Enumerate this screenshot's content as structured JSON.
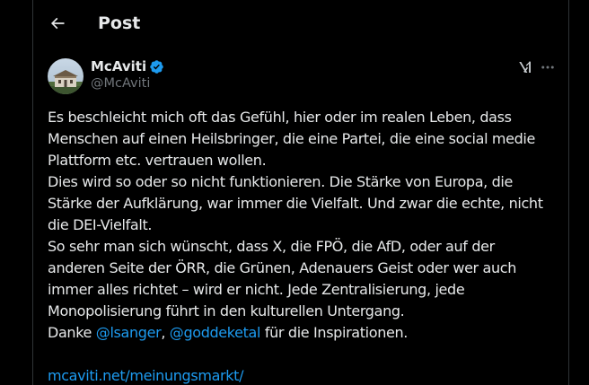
{
  "header": {
    "title": "Post"
  },
  "author": {
    "name": "McAviti",
    "handle": "@McAviti",
    "verified": true,
    "verified_color": "#1d9bf0"
  },
  "actions": {
    "grok_icon": "grok-icon",
    "more_icon": "more-icon"
  },
  "post": {
    "paragraphs": [
      "Es beschleicht mich oft das Gefühl, hier oder im realen Leben, dass Menschen auf einen Heilsbringer, die eine Partei, die eine social medie Plattform etc. vertrauen wollen.",
      "Dies wird so oder so nicht funktionieren. Die Stärke von Europa, die Stärke der Aufklärung, war immer die Vielfalt. Und zwar die echte, nicht die DEI-Vielfalt.",
      "So sehr man sich wünscht, dass X, die FPÖ, die AfD, oder auf der anderen Seite der ÖRR, die Grünen, Adenauers Geist oder wer auch immer alles richtet – wird er nicht. Jede Zentralisierung, jede Monopolisierung führt in den kulturellen Untergang."
    ],
    "thanks_prefix": "Danke ",
    "mention_1": "@lsanger",
    "separator": ", ",
    "mention_2": "@goddeketal",
    "thanks_suffix": " für die Inspirationen.",
    "link": "mcaviti.net/meinungsmarkt/"
  },
  "colors": {
    "background": "#000000",
    "text": "#e7e9ea",
    "secondary": "#71767b",
    "accent": "#1d9bf0",
    "border": "#2f3336"
  }
}
